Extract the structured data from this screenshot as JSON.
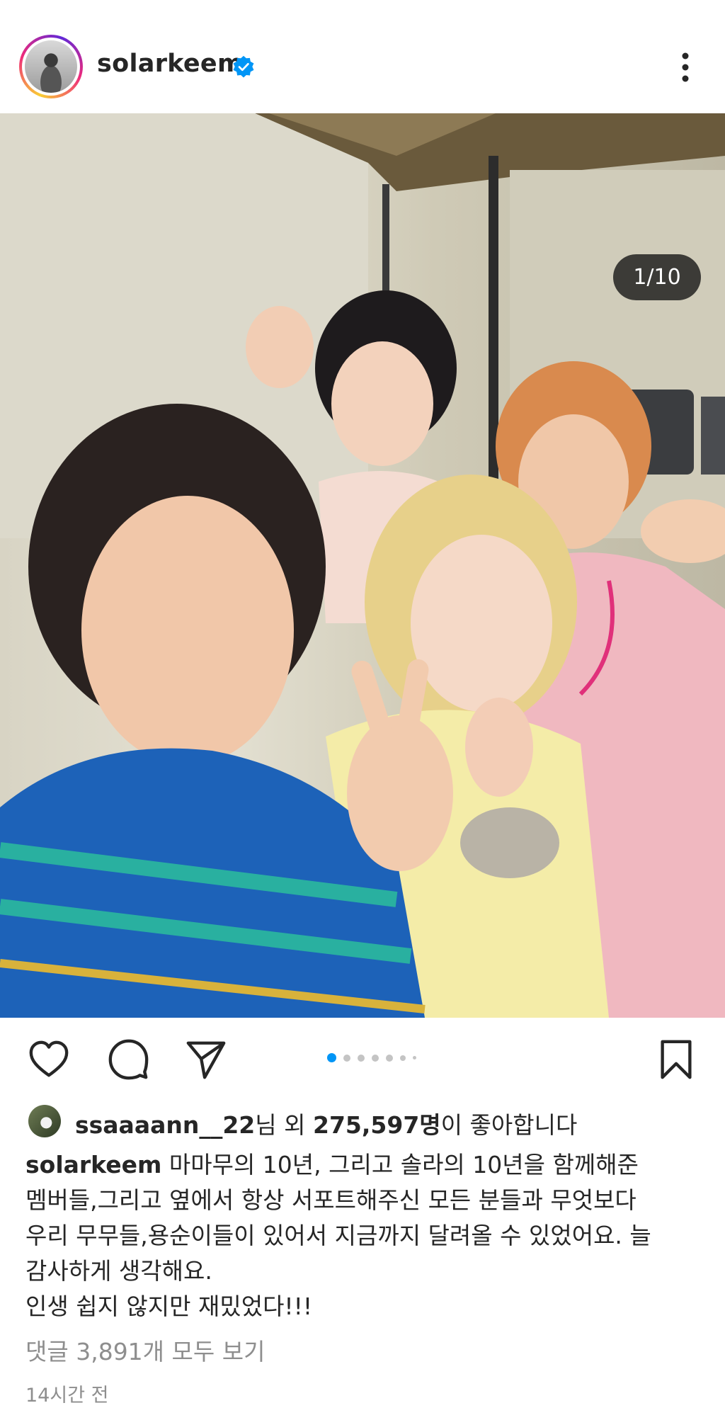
{
  "header": {
    "username": "solarkeem",
    "verified_icon": "verified-badge-icon",
    "more_icon": "more-vertical-icon"
  },
  "photo": {
    "counter": "1/10",
    "alt_icon": "post-photo"
  },
  "actions": {
    "like_icon": "heart-icon",
    "comment_icon": "comment-icon",
    "share_icon": "send-icon",
    "save_icon": "bookmark-icon",
    "carousel_dots": 7,
    "active_dot": 1
  },
  "likes": {
    "liker": "ssaaaann__22",
    "suffix1": "님 외 ",
    "count": "275,597명",
    "suffix2": "이 좋아합니다"
  },
  "caption": {
    "author": "solarkeem",
    "line1": " 마마무의 10년, 그리고 솔라의 10년을 함께해준",
    "line2": "멤버들,그리고 옆에서 항상 서포트해주신 모든 분들과 무엇보다",
    "line3": "우리 무무들,용순이들이 있어서 지금까지 달려올 수 있었어요. 늘",
    "line4": "감사하게 생각해요.",
    "line5": "인생 쉽지 않지만 재밌었다!!!"
  },
  "comments_link": "댓글 3,891개 모두 보기",
  "timestamp": "14시간 전",
  "colors": {
    "accent_blue": "#0095f6",
    "text": "#262626",
    "muted": "#8e8e8e"
  }
}
